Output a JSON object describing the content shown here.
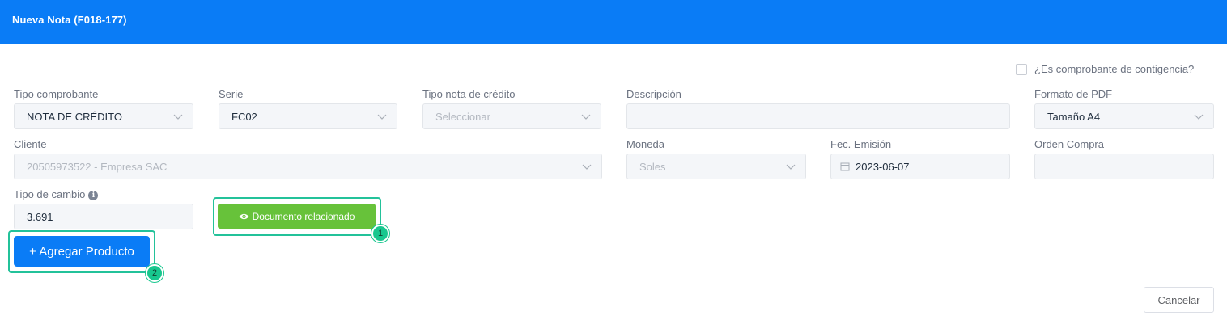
{
  "header": {
    "title": "Nueva Nota (F018-177)",
    "background": "#0a7cf6"
  },
  "contingency": {
    "label": "¿Es comprobante de contigencia?",
    "checked": false
  },
  "form": {
    "tipo_comprobante": {
      "label": "Tipo comprobante",
      "value": "NOTA DE CRÉDITO"
    },
    "serie": {
      "label": "Serie",
      "value": "FC02"
    },
    "tipo_nota": {
      "label": "Tipo nota de crédito",
      "placeholder": "Seleccionar"
    },
    "descripcion": {
      "label": "Descripción",
      "value": ""
    },
    "formato_pdf": {
      "label": "Formato de PDF",
      "value": "Tamaño A4"
    },
    "cliente": {
      "label": "Cliente",
      "value": "20505973522 - Empresa SAC"
    },
    "moneda": {
      "label": "Moneda",
      "value": "Soles"
    },
    "fec_emision": {
      "label": "Fec. Emisión",
      "value": "2023-06-07"
    },
    "orden_compra": {
      "label": "Orden Compra",
      "value": ""
    },
    "tipo_cambio": {
      "label": "Tipo de cambio",
      "value": "3.691"
    }
  },
  "buttons": {
    "documento_relacionado": "Documento relacionado",
    "agregar_producto": "+ Agregar Producto",
    "cancelar": "Cancelar"
  },
  "markers": {
    "first": "1",
    "second": "2"
  },
  "colors": {
    "primary": "#0a7cf6",
    "success": "#67c23a",
    "highlight": "#23c29a"
  }
}
